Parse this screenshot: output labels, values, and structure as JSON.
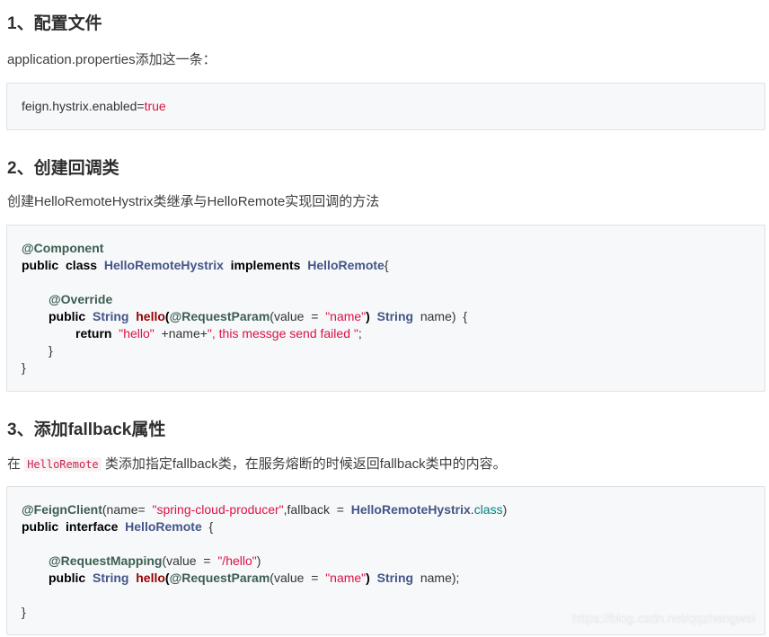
{
  "sections": [
    {
      "heading": "1、配置文件",
      "desc": "application.properties添加这一条："
    },
    {
      "heading": "2、创建回调类",
      "desc": "创建HelloRemoteHystrix类继承与HelloRemote实现回调的方法"
    },
    {
      "heading": "3、添加fallback属性",
      "desc_prefix": "在",
      "desc_code": "HelloRemote",
      "desc_suffix": "类添加指定fallback类，在服务熔断的时候返回fallback类中的内容。"
    }
  ],
  "code1": {
    "key": "feign.hystrix.enabled=",
    "value": "true"
  },
  "code2": {
    "annotation_component": "@Component",
    "kw_public": "public",
    "kw_class": "class",
    "class_name": "HelloRemoteHystrix",
    "kw_implements": "implements",
    "iface": "HelloRemote",
    "brace_open": "{",
    "annotation_override": "@Override",
    "type_string": "String",
    "method": "hello",
    "annotation_param": "@RequestParam",
    "param_open": "(value",
    "eq": "=",
    "str_name": "\"name\"",
    "param_close": ")",
    "param_var": "name)",
    "method_brace": "{",
    "kw_return": "return",
    "str_hello": "\"hello\"",
    "concat": "+name+",
    "str_msg": "\", this messge send failed \"",
    "semicolon": ";",
    "close_method": "}",
    "close_class": "}"
  },
  "code3": {
    "annotation_feign": "@FeignClient",
    "name_attr": "(name=",
    "str_producer": "\"spring-cloud-producer\"",
    "fallback_attr": ",fallback",
    "eq": "=",
    "fallback_class": "HelloRemoteHystrix",
    "dot_class": ".",
    "class_kw": "class",
    "close_paren": ")",
    "kw_public": "public",
    "kw_interface": "interface",
    "iface": "HelloRemote",
    "brace_open": "{",
    "annotation_mapping": "@RequestMapping",
    "value_attr": "(value",
    "str_path": "\"/hello\"",
    "close_mapping": ")",
    "type_string": "String",
    "method": "hello",
    "annotation_param": "@RequestParam",
    "param_open": "(value",
    "str_name": "\"name\"",
    "param_close": ")",
    "param_var": "name);",
    "brace_close": "}"
  },
  "watermark": "https://blog.csdn.net/qqzhengwei"
}
